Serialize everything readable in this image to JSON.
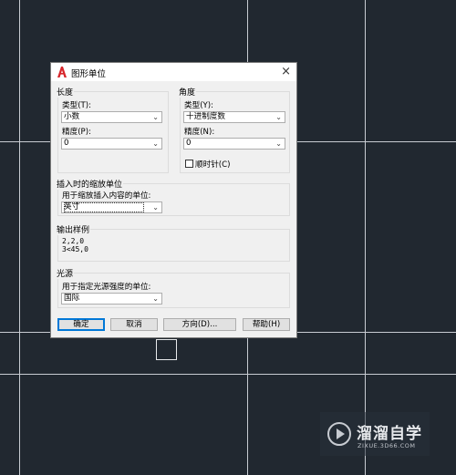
{
  "dialog": {
    "title": "图形单位",
    "close_glyph": "×",
    "length": {
      "legend": "长度",
      "type_label": "类型(T):",
      "type_value": "小数",
      "precision_label": "精度(P):",
      "precision_value": "0"
    },
    "angle": {
      "legend": "角度",
      "type_label": "类型(Y):",
      "type_value": "十进制度数",
      "precision_label": "精度(N):",
      "precision_value": "0",
      "clockwise_label": "顺时针(C)",
      "clockwise_checked": false
    },
    "insertion": {
      "legend": "插入时的缩放单位",
      "desc": "用于缩放插入内容的单位:",
      "value": "英寸"
    },
    "sample": {
      "legend": "输出样例",
      "line1": "2,2,0",
      "line2": "3<45,0"
    },
    "lighting": {
      "legend": "光源",
      "desc": "用于指定光源强度的单位:",
      "value": "国际"
    },
    "buttons": {
      "ok": "确定",
      "cancel": "取消",
      "direction": "方向(D)...",
      "help": "帮助(H)"
    }
  },
  "watermark": {
    "name": "溜溜自学",
    "url": "ZIXUE.3D66.COM"
  },
  "colors": {
    "canvas_bg": "#212830",
    "app_icon_red": "#d7262b",
    "default_button_border": "#0078d7"
  },
  "icons": {
    "app": "autocad-a-icon",
    "close": "close-icon",
    "dropdown": "chevron-down-icon",
    "watermark": "play-circle-icon"
  }
}
